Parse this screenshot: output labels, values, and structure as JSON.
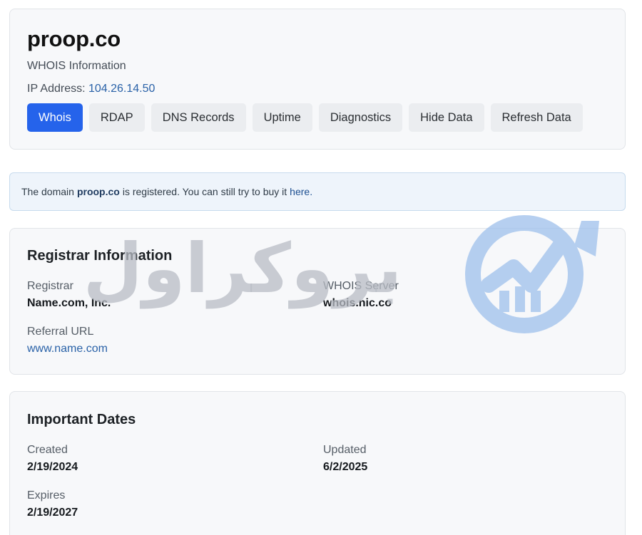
{
  "header": {
    "domain": "proop.co",
    "subtitle": "WHOIS Information",
    "ip_label": "IP Address:",
    "ip_value": "104.26.14.50",
    "tabs": [
      {
        "label": "Whois",
        "active": true
      },
      {
        "label": "RDAP"
      },
      {
        "label": "DNS Records"
      },
      {
        "label": "Uptime"
      },
      {
        "label": "Diagnostics"
      },
      {
        "label": "Hide Data"
      },
      {
        "label": "Refresh Data"
      }
    ]
  },
  "notice": {
    "prefix": "The domain",
    "domain": "proop.co",
    "middle": "is registered. You can still try to buy it",
    "link": "here."
  },
  "registrar": {
    "title": "Registrar Information",
    "registrar_label": "Registrar",
    "registrar_value": "Name.com, Inc.",
    "whois_server_label": "WHOIS Server",
    "whois_server_value": "whois.nic.co",
    "referral_label": "Referral URL",
    "referral_value": "www.name.com"
  },
  "dates": {
    "title": "Important Dates",
    "created_label": "Created",
    "created_value": "2/19/2024",
    "updated_label": "Updated",
    "updated_value": "6/2/2025",
    "expires_label": "Expires",
    "expires_value": "2/19/2027"
  },
  "watermark": {
    "text": "بروکراول",
    "icon": "chart-up-arrow-logo"
  },
  "colors": {
    "accent": "#2563eb",
    "link": "#2a62a8",
    "card_bg": "#f7f8fa",
    "notice_bg": "#eef4fb"
  }
}
